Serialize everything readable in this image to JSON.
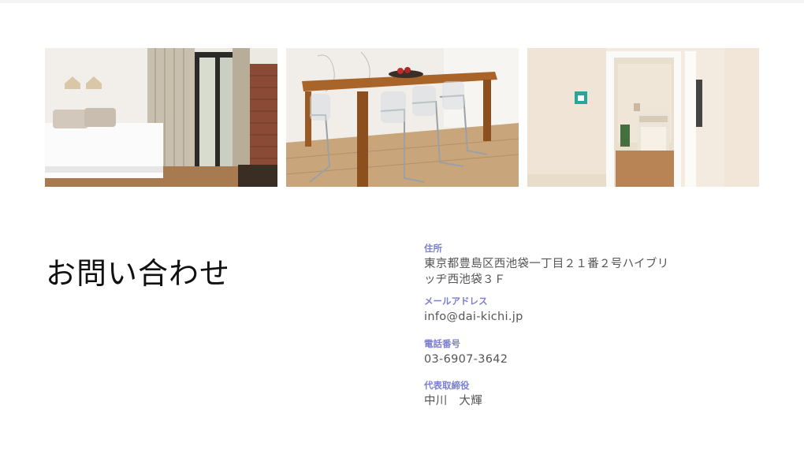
{
  "section": {
    "title": "お問い合わせ"
  },
  "gallery": {
    "photos": [
      {
        "name": "bedroom"
      },
      {
        "name": "dining-room"
      },
      {
        "name": "hallway-kitchen"
      }
    ]
  },
  "contact": {
    "address": {
      "label": "住所",
      "line1": "東京都豊島区西池袋一丁目２１番２号ハイブリ",
      "line2": "ッヂ西池袋３Ｆ"
    },
    "email": {
      "label": "メールアドレス",
      "value": "info@dai-kichi.jp"
    },
    "phone": {
      "label": "電話番号",
      "value": "03-6907-3642"
    },
    "representative": {
      "label": "代表取締役",
      "value": "中川　大輝"
    }
  }
}
